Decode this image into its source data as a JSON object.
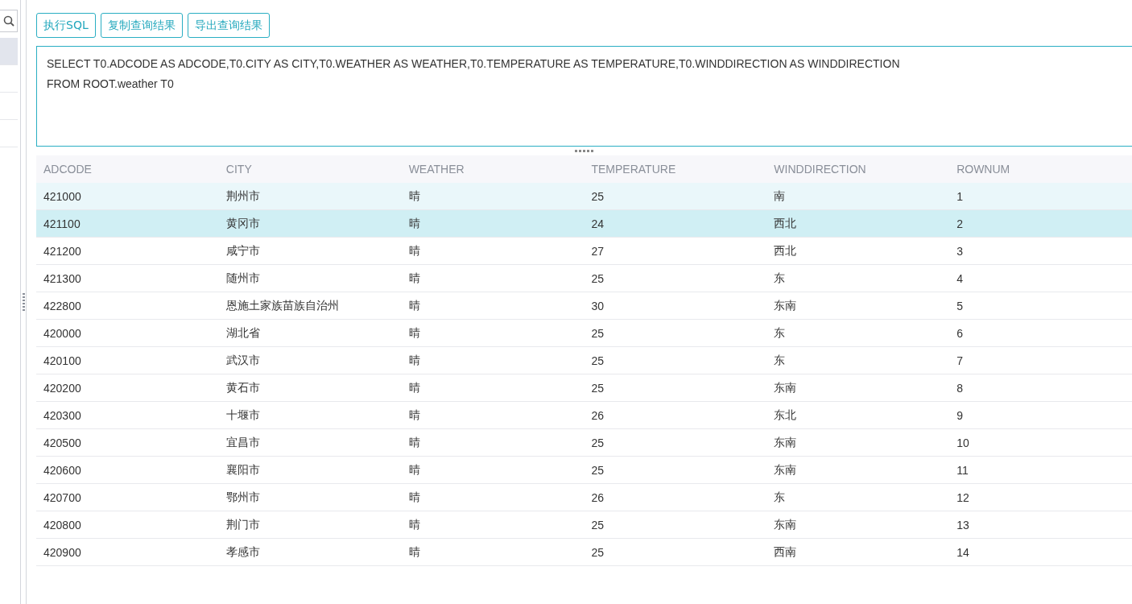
{
  "toolbar": {
    "buttons": [
      "执行SQL",
      "复制查询结果",
      "导出查询结果"
    ]
  },
  "sidebar": {
    "items": [
      {
        "selected": true
      },
      {
        "selected": false
      },
      {
        "selected": false
      },
      {
        "selected": false
      }
    ]
  },
  "editor": {
    "value": "SELECT T0.ADCODE AS ADCODE,T0.CITY AS CITY,T0.WEATHER AS WEATHER,T0.TEMPERATURE AS TEMPERATURE,T0.WINDDIRECTION AS WINDDIRECTION\nFROM ROOT.weather T0"
  },
  "table": {
    "columns": [
      "ADCODE",
      "CITY",
      "WEATHER",
      "TEMPERATURE",
      "WINDDIRECTION",
      "ROWNUM"
    ],
    "rows": [
      {
        "cells": [
          "421000",
          "荆州市",
          "晴",
          "25",
          "南",
          "1"
        ],
        "hovered": true,
        "selected": false
      },
      {
        "cells": [
          "421100",
          "黄冈市",
          "晴",
          "24",
          "西北",
          "2"
        ],
        "hovered": false,
        "selected": true
      },
      {
        "cells": [
          "421200",
          "咸宁市",
          "晴",
          "27",
          "西北",
          "3"
        ],
        "hovered": false,
        "selected": false
      },
      {
        "cells": [
          "421300",
          "随州市",
          "晴",
          "25",
          "东",
          "4"
        ],
        "hovered": false,
        "selected": false
      },
      {
        "cells": [
          "422800",
          "恩施土家族苗族自治州",
          "晴",
          "30",
          "东南",
          "5"
        ],
        "hovered": false,
        "selected": false
      },
      {
        "cells": [
          "420000",
          "湖北省",
          "晴",
          "25",
          "东",
          "6"
        ],
        "hovered": false,
        "selected": false
      },
      {
        "cells": [
          "420100",
          "武汉市",
          "晴",
          "25",
          "东",
          "7"
        ],
        "hovered": false,
        "selected": false
      },
      {
        "cells": [
          "420200",
          "黄石市",
          "晴",
          "25",
          "东南",
          "8"
        ],
        "hovered": false,
        "selected": false
      },
      {
        "cells": [
          "420300",
          "十堰市",
          "晴",
          "26",
          "东北",
          "9"
        ],
        "hovered": false,
        "selected": false
      },
      {
        "cells": [
          "420500",
          "宜昌市",
          "晴",
          "25",
          "东南",
          "10"
        ],
        "hovered": false,
        "selected": false
      },
      {
        "cells": [
          "420600",
          "襄阳市",
          "晴",
          "25",
          "东南",
          "11"
        ],
        "hovered": false,
        "selected": false
      },
      {
        "cells": [
          "420700",
          "鄂州市",
          "晴",
          "26",
          "东",
          "12"
        ],
        "hovered": false,
        "selected": false
      },
      {
        "cells": [
          "420800",
          "荆门市",
          "晴",
          "25",
          "东南",
          "13"
        ],
        "hovered": false,
        "selected": false
      },
      {
        "cells": [
          "420900",
          "孝感市",
          "晴",
          "25",
          "西南",
          "14"
        ],
        "hovered": false,
        "selected": false
      }
    ]
  }
}
